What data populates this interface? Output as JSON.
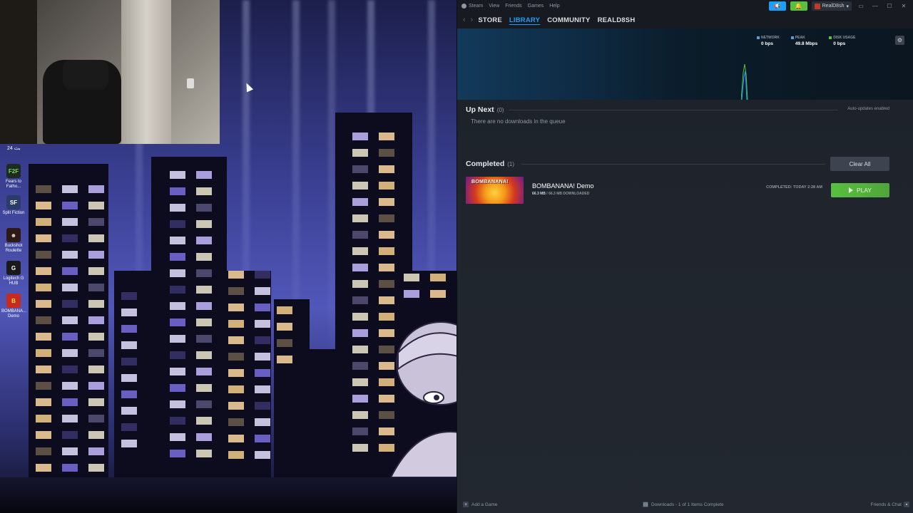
{
  "desktop": {
    "clock_tag": "بث 24",
    "icons": [
      {
        "label": "Fears to Fatho...",
        "glyph": "F2F",
        "bg": "#1d2b22",
        "fg": "#78d85a"
      },
      {
        "label": "Split Fiction",
        "glyph": "SF",
        "bg": "#2a3c6a",
        "fg": "#ffffff"
      },
      {
        "label": "Buckshot Roulette",
        "glyph": "☻",
        "bg": "#2d1a16",
        "fg": "#e3d4c0"
      },
      {
        "label": "Logitech G HUB",
        "glyph": "G",
        "bg": "#1a1a1a",
        "fg": "#ffffff"
      },
      {
        "label": "BOMBANA... Demo",
        "glyph": "B",
        "bg": "#c72b20",
        "fg": "#ffe14d"
      }
    ]
  },
  "steam": {
    "titlebar": {
      "menu": [
        "Steam",
        "View",
        "Friends",
        "Games",
        "Help"
      ],
      "broadcast_icon": "megaphone-icon",
      "notification_icon": "bell-icon",
      "username": "RealD8sh",
      "window_controls": [
        "▭",
        "—",
        "☐",
        "✕"
      ]
    },
    "nav": {
      "back": "‹",
      "forward": "›",
      "tabs": [
        "STORE",
        "LIBRARY",
        "COMMUNITY",
        "REALD8SH"
      ],
      "active_tab": "LIBRARY"
    },
    "graph": {
      "stats": [
        {
          "label": "NETWORK",
          "value": "0 bps",
          "color": "#5aa0d8"
        },
        {
          "label": "PEAK",
          "value": "49.8 Mbps",
          "color": "#5aa0d8"
        },
        {
          "label": "DISK USAGE",
          "value": "0 bps",
          "color": "#59bf40"
        }
      ],
      "settings_icon": "gear-icon"
    },
    "up_next": {
      "title": "Up Next",
      "count": "(0)",
      "auto_updates": "Auto-updates enabled",
      "empty_text": "There are no downloads in the queue"
    },
    "completed": {
      "title": "Completed",
      "count": "(1)",
      "clear_all": "Clear All",
      "items": [
        {
          "thumb_text": "BOMBANANA!",
          "name": "BOMBANANA! Demo",
          "size_current": "66.3 MB",
          "size_rest": " / 66.3 MB DOWNLOADED",
          "completed_label": "COMPLETED: TODAY 2:28 AM",
          "play_label": "PLAY"
        }
      ]
    },
    "footer": {
      "add_game": "Add a Game",
      "downloads_status": "Downloads - 1 of 1 Items Complete",
      "friends_chat": "Friends & Chat"
    }
  }
}
